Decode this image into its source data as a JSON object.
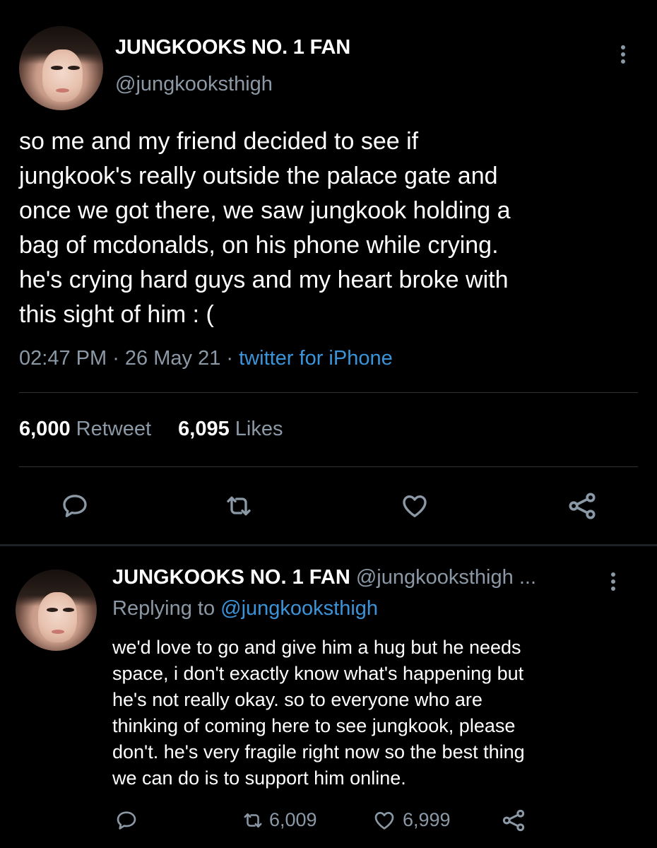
{
  "main_tweet": {
    "display_name": "JUNGKOOKS NO. 1 FAN",
    "handle": "@jungkooksthigh",
    "text_lines": [
      "so me and my friend decided to see if",
      "jungkook's really outside the palace gate and",
      "once we got there, we saw jungkook holding a",
      "bag of mcdonalds, on his phone while crying.",
      "he's crying hard guys and my heart broke with",
      "this sight of him : ("
    ],
    "time": "02:47 PM",
    "date": "26 May 21",
    "source": "twitter for iPhone",
    "retweet_count": "6,000",
    "retweet_label": "Retweet",
    "like_count": "6,095",
    "like_label": "Likes"
  },
  "reply_tweet": {
    "display_name": "JUNGKOOKS NO. 1 FAN",
    "handle": "@jungkooksthigh",
    "ellipsis": "...",
    "replying_prefix": "Replying to",
    "replying_handle": "@jungkooksthigh",
    "text_lines": [
      "we'd love to go and give him a hug but he needs",
      "space, i don't exactly know what's happening but",
      "he's not really okay. so to everyone who are",
      "thinking of coming here to see jungkook, please",
      "don't. he's very fragile right now so the best thing",
      "we can do is to support him online."
    ],
    "retweet_count": "6,009",
    "like_count": "6,999"
  },
  "colors": {
    "background": "#000000",
    "text": "#ffffff",
    "muted": "#8b98a5",
    "link": "#3b94d9",
    "divider": "#2f3336"
  },
  "icons": {
    "reply": "speech-bubble-icon",
    "retweet": "retweet-icon",
    "like": "heart-icon",
    "share": "share-icon",
    "more": "vertical-dots-icon"
  }
}
